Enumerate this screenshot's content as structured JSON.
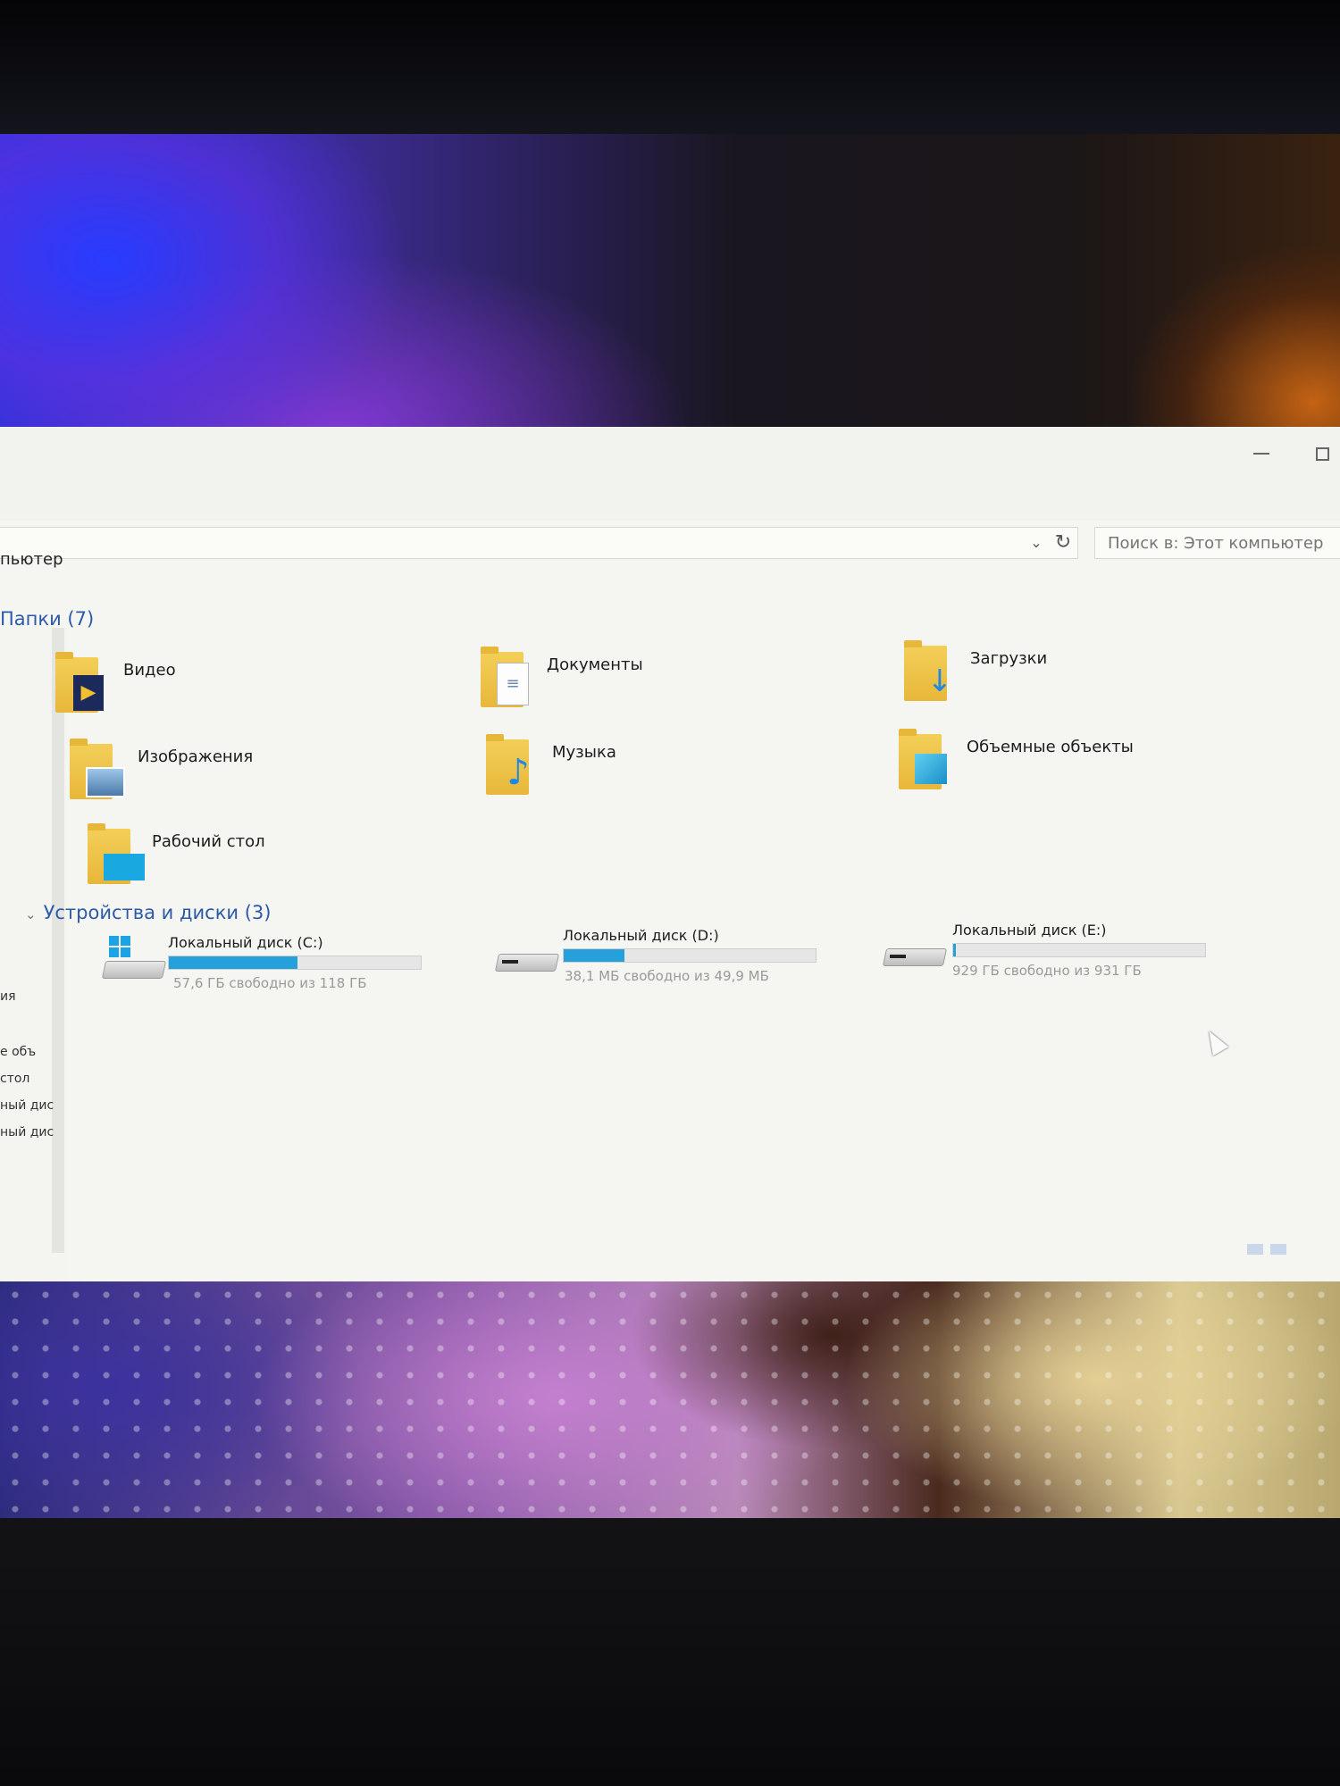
{
  "address": {
    "text": "пьютер"
  },
  "search": {
    "placeholder": "Поиск в: Этот компьютер"
  },
  "folders_group": {
    "header": "Папки (7)",
    "items": [
      {
        "label": "Видео",
        "icon": "video-icon"
      },
      {
        "label": "Документы",
        "icon": "document-icon"
      },
      {
        "label": "Загрузки",
        "icon": "download-arrow-icon"
      },
      {
        "label": "Изображения",
        "icon": "image-icon"
      },
      {
        "label": "Музыка",
        "icon": "music-note-icon"
      },
      {
        "label": "Объемные объекты",
        "icon": "cube-icon"
      },
      {
        "label": "Рабочий стол",
        "icon": "desktop-icon"
      }
    ]
  },
  "drives_group": {
    "header": "Устройства и диски (3)",
    "items": [
      {
        "name": "Локальный диск (C:)",
        "free_text": "57,6 ГБ свободно из 118 ГБ",
        "used_fraction": 0.51
      },
      {
        "name": "Локальный диск (D:)",
        "free_text": "38,1 МБ свободно из 49,9 МБ",
        "used_fraction": 0.24
      },
      {
        "name": "Локальный диск (E:)",
        "free_text": "929 ГБ свободно из 931 ГБ",
        "used_fraction": 0.01
      }
    ]
  },
  "nav_pane": {
    "items": [
      "ия",
      "е объ",
      "стол",
      "ный дис",
      "ный дис"
    ]
  },
  "colors": {
    "accent": "#26a0da",
    "group_header": "#2c5aa8",
    "folder": "#f3cf58"
  }
}
